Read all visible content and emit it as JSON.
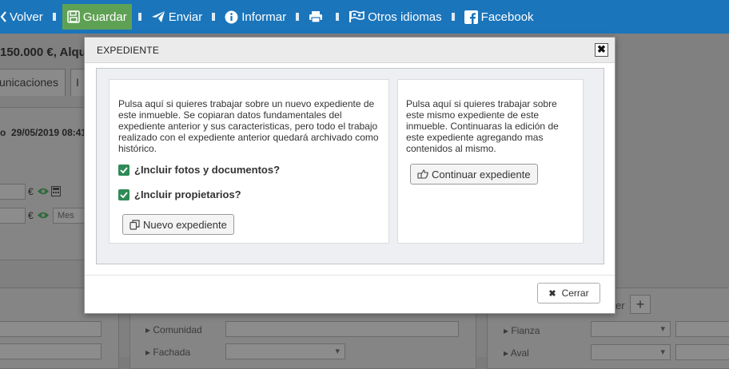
{
  "toolbar": {
    "volver": "Volver",
    "guardar": "Guardar",
    "enviar": "Enviar",
    "informar": "Informar",
    "otros_idiomas": "Otros idiomas",
    "facebook": "Facebook",
    "colors": {
      "bar": "#1b75bb",
      "guardar_bg": "#5fa154"
    }
  },
  "background": {
    "title_fragment": "150.000 €, Alqu",
    "tab_fragment": "unicaciones",
    "tab2_fragment": "I",
    "date_label_fragment": "o",
    "date_value": "29/05/2019 08:41",
    "currency_symbol": "€",
    "mes_placeholder": "Mes",
    "comunidad": "Comunidad",
    "fachada": "Fachada",
    "fianza": "Fianza",
    "aval": "Aval",
    "er_fragment": "er",
    "plus": "+"
  },
  "modal": {
    "title": "EXPEDIENTE",
    "close_glyph": "✖",
    "left_text": "Pulsa aquí si quieres trabajar sobre un nuevo expediente de este inmueble. Se copiaran datos fundamentales del expediente anterior y sus caracteristicas, pero todo el trabajo realizado con el expediente anterior quedará archivado como histórico.",
    "checkbox_fotos": "¿Incluir fotos y documentos?",
    "checkbox_propietarios": "¿Incluir propietarios?",
    "btn_nuevo": "Nuevo expediente",
    "right_text": "Pulsa aquí si quieres trabajar sobre este mismo expediente de este inmueble. Continuaras la edición de este expediente agregando mas contenidos al mismo.",
    "btn_continuar": "Continuar expediente",
    "btn_cerrar": "Cerrar",
    "check_color": "#2e8b57"
  }
}
